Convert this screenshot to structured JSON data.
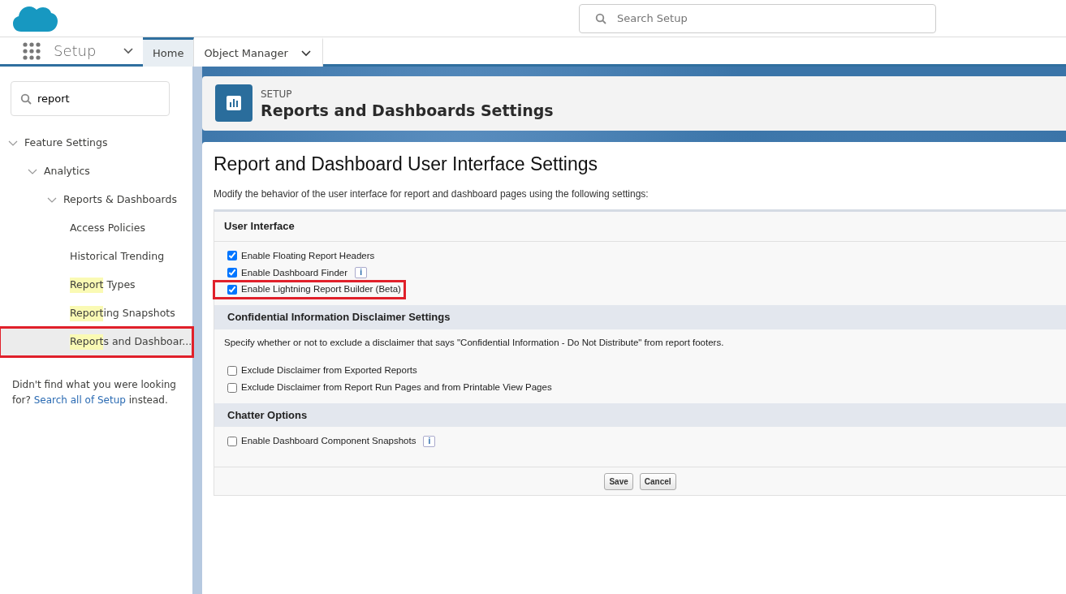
{
  "header": {
    "search": {
      "placeholder": "Search Setup"
    }
  },
  "app_nav": {
    "app_name": "Setup",
    "tabs": [
      {
        "label": "Home",
        "selected": true,
        "menu": false
      },
      {
        "label": "Object Manager",
        "selected": false,
        "menu": true
      }
    ]
  },
  "sidebar": {
    "search": {
      "value": "report"
    },
    "tree": [
      {
        "label": "Feature Settings",
        "expanded": true,
        "children": [
          {
            "label": "Analytics",
            "expanded": true,
            "children": [
              {
                "label": "Reports & Dashboards",
                "expanded": true,
                "children": [
                  {
                    "rest": "Access Policies",
                    "selected": false,
                    "annotated": false
                  },
                  {
                    "rest": "Historical Trending",
                    "selected": false,
                    "annotated": false
                  },
                  {
                    "match": "Report",
                    "rest": " Types",
                    "selected": false,
                    "annotated": false
                  },
                  {
                    "match": "Report",
                    "rest": "ing Snapshots",
                    "selected": false,
                    "annotated": false
                  },
                  {
                    "match": "Report",
                    "rest": "s and Dashboar...",
                    "selected": true,
                    "annotated": true
                  }
                ]
              }
            ]
          }
        ]
      }
    ],
    "not_found": {
      "text": "Didn't find what you were looking for?",
      "link": "Search all of Setup",
      "after": "instead."
    }
  },
  "page_header": {
    "eyebrow": "SETUP",
    "title": "Reports and Dashboards Settings"
  },
  "content": {
    "title": "Report and Dashboard User Interface Settings",
    "description": "Modify the behavior of the user interface for report and dashboard pages using the following settings:",
    "sections": [
      {
        "title": "User Interface",
        "kind": "plain",
        "options": [
          {
            "label": "Enable Floating Report Headers",
            "checked": true,
            "annotated": false
          },
          {
            "label": "Enable Dashboard Finder",
            "checked": true,
            "info": "i",
            "annotated": false
          },
          {
            "label": "Enable Lightning Report Builder (Beta)",
            "checked": true,
            "annotated": true
          }
        ]
      },
      {
        "title": "Confidential Information Disclaimer Settings",
        "kind": "shaded",
        "text": "Specify whether or not to exclude a disclaimer that says \"Confidential Information - Do Not Distribute\" from report footers.",
        "options": [
          {
            "label": "Exclude Disclaimer from Exported Reports",
            "checked": false,
            "annotated": false
          },
          {
            "label": "Exclude Disclaimer from Report Run Pages and from Printable View Pages",
            "checked": false,
            "annotated": false
          }
        ]
      },
      {
        "title": "Chatter Options",
        "kind": "shaded",
        "options": [
          {
            "label": "Enable Dashboard Component Snapshots",
            "checked": false,
            "info": "i",
            "annotated": false
          }
        ]
      }
    ],
    "buttons": [
      "Save",
      "Cancel"
    ]
  }
}
